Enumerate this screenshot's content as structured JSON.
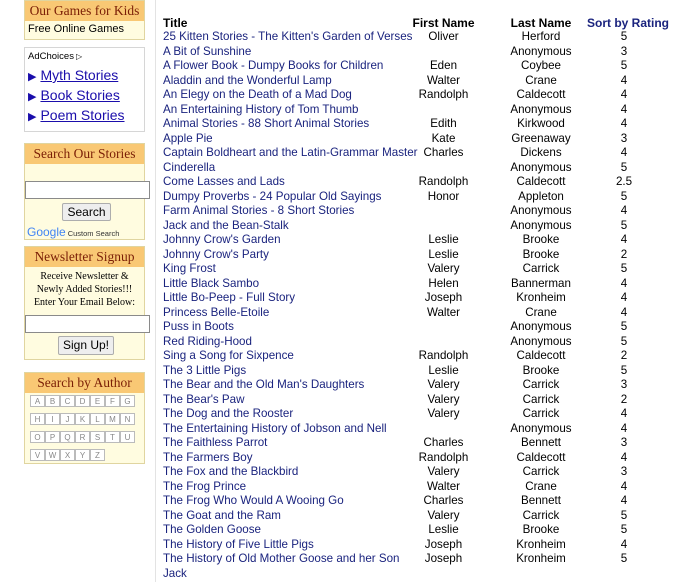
{
  "sidebar": {
    "games": {
      "title": "Our Games for Kids",
      "link": "Free Online Games"
    },
    "ad": {
      "adchoices": "AdChoices",
      "links": [
        "Myth Stories",
        "Book Stories",
        "Poem Stories"
      ]
    },
    "search": {
      "title": "Search Our Stories",
      "button": "Search",
      "google": "Google",
      "custom": "Custom Search"
    },
    "newsletter": {
      "title": "Newsletter Signup",
      "text1": "Receive Newsletter &",
      "text2": "Newly Added Stories!!!",
      "text3": "Enter Your Email Below:",
      "button": "Sign Up!"
    },
    "author": {
      "title": "Search by Author",
      "letters": [
        "A",
        "B",
        "C",
        "D",
        "E",
        "F",
        "G",
        "H",
        "I",
        "J",
        "K",
        "L",
        "M",
        "N",
        "O",
        "P",
        "Q",
        "R",
        "S",
        "T",
        "U",
        "V",
        "W",
        "X",
        "Y",
        "Z"
      ]
    }
  },
  "table": {
    "headers": {
      "title": "Title",
      "first": "First Name",
      "last": "Last Name",
      "rating": "Sort by Rating"
    },
    "rows": [
      {
        "title": "25 Kitten Stories - The Kitten's Garden of Verses",
        "first": "Oliver",
        "last": "Herford",
        "rating": "5"
      },
      {
        "title": "A Bit of Sunshine",
        "first": "",
        "last": "Anonymous",
        "rating": "3"
      },
      {
        "title": "A Flower Book - Dumpy Books for Children",
        "first": "Eden",
        "last": "Coybee",
        "rating": "5"
      },
      {
        "title": "Aladdin and the Wonderful Lamp",
        "first": "Walter",
        "last": "Crane",
        "rating": "4"
      },
      {
        "title": "An Elegy on the Death of a Mad Dog",
        "first": "Randolph",
        "last": "Caldecott",
        "rating": "4"
      },
      {
        "title": "An Entertaining History of Tom Thumb",
        "first": "",
        "last": "Anonymous",
        "rating": "4"
      },
      {
        "title": "Animal Stories - 88 Short Animal Stories",
        "first": "Edith",
        "last": "Kirkwood",
        "rating": "4"
      },
      {
        "title": "Apple Pie",
        "first": "Kate",
        "last": "Greenaway",
        "rating": "3"
      },
      {
        "title": "Captain Boldheart and the Latin-Grammar Master",
        "first": "Charles",
        "last": "Dickens",
        "rating": "4"
      },
      {
        "title": "Cinderella",
        "first": "",
        "last": "Anonymous",
        "rating": "5"
      },
      {
        "title": "Come Lasses and Lads",
        "first": "Randolph",
        "last": "Caldecott",
        "rating": "2.5"
      },
      {
        "title": "Dumpy Proverbs - 24 Popular Old Sayings",
        "first": "Honor",
        "last": "Appleton",
        "rating": "5"
      },
      {
        "title": "Farm Animal Stories - 8 Short Stories",
        "first": "",
        "last": "Anonymous",
        "rating": "4"
      },
      {
        "title": "Jack and the Bean-Stalk",
        "first": "",
        "last": "Anonymous",
        "rating": "5"
      },
      {
        "title": "Johnny Crow's Garden",
        "first": "Leslie",
        "last": "Brooke",
        "rating": "4"
      },
      {
        "title": "Johnny Crow's Party",
        "first": "Leslie",
        "last": "Brooke",
        "rating": "2"
      },
      {
        "title": "King Frost",
        "first": "Valery",
        "last": "Carrick",
        "rating": "5"
      },
      {
        "title": "Little Black Sambo",
        "first": "Helen",
        "last": "Bannerman",
        "rating": "4"
      },
      {
        "title": "Little Bo-Peep - Full Story",
        "first": "Joseph",
        "last": "Kronheim",
        "rating": "4"
      },
      {
        "title": "Princess Belle-Etoile",
        "first": "Walter",
        "last": "Crane",
        "rating": "4"
      },
      {
        "title": "Puss in Boots",
        "first": "",
        "last": "Anonymous",
        "rating": "5"
      },
      {
        "title": "Red Riding-Hood",
        "first": "",
        "last": "Anonymous",
        "rating": "5"
      },
      {
        "title": "Sing a Song for Sixpence",
        "first": "Randolph",
        "last": "Caldecott",
        "rating": "2"
      },
      {
        "title": "The 3 Little Pigs",
        "first": "Leslie",
        "last": "Brooke",
        "rating": "5"
      },
      {
        "title": "The Bear and the Old Man's Daughters",
        "first": "Valery",
        "last": "Carrick",
        "rating": "3"
      },
      {
        "title": "The Bear's Paw",
        "first": "Valery",
        "last": "Carrick",
        "rating": "2"
      },
      {
        "title": "The Dog and the Rooster",
        "first": "Valery",
        "last": "Carrick",
        "rating": "4"
      },
      {
        "title": "The Entertaining History of Jobson and Nell",
        "first": "",
        "last": "Anonymous",
        "rating": "4"
      },
      {
        "title": "The Faithless Parrot",
        "first": "Charles",
        "last": "Bennett",
        "rating": "3"
      },
      {
        "title": "The Farmers Boy",
        "first": "Randolph",
        "last": "Caldecott",
        "rating": "4"
      },
      {
        "title": "The Fox and the Blackbird",
        "first": "Valery",
        "last": "Carrick",
        "rating": "3"
      },
      {
        "title": "The Frog Prince",
        "first": "Walter",
        "last": "Crane",
        "rating": "4"
      },
      {
        "title": "The Frog Who Would A Wooing Go",
        "first": "Charles",
        "last": "Bennett",
        "rating": "4"
      },
      {
        "title": "The Goat and the Ram",
        "first": "Valery",
        "last": "Carrick",
        "rating": "5"
      },
      {
        "title": "The Golden Goose",
        "first": "Leslie",
        "last": "Brooke",
        "rating": "5"
      },
      {
        "title": "The History of Five Little Pigs",
        "first": "Joseph",
        "last": "Kronheim",
        "rating": "4"
      },
      {
        "title": "The History of Old Mother Goose and her Son",
        "first": "Joseph",
        "last": "Kronheim",
        "rating": "5"
      },
      {
        "title": "Jack",
        "first": "",
        "last": "",
        "rating": ""
      }
    ]
  }
}
